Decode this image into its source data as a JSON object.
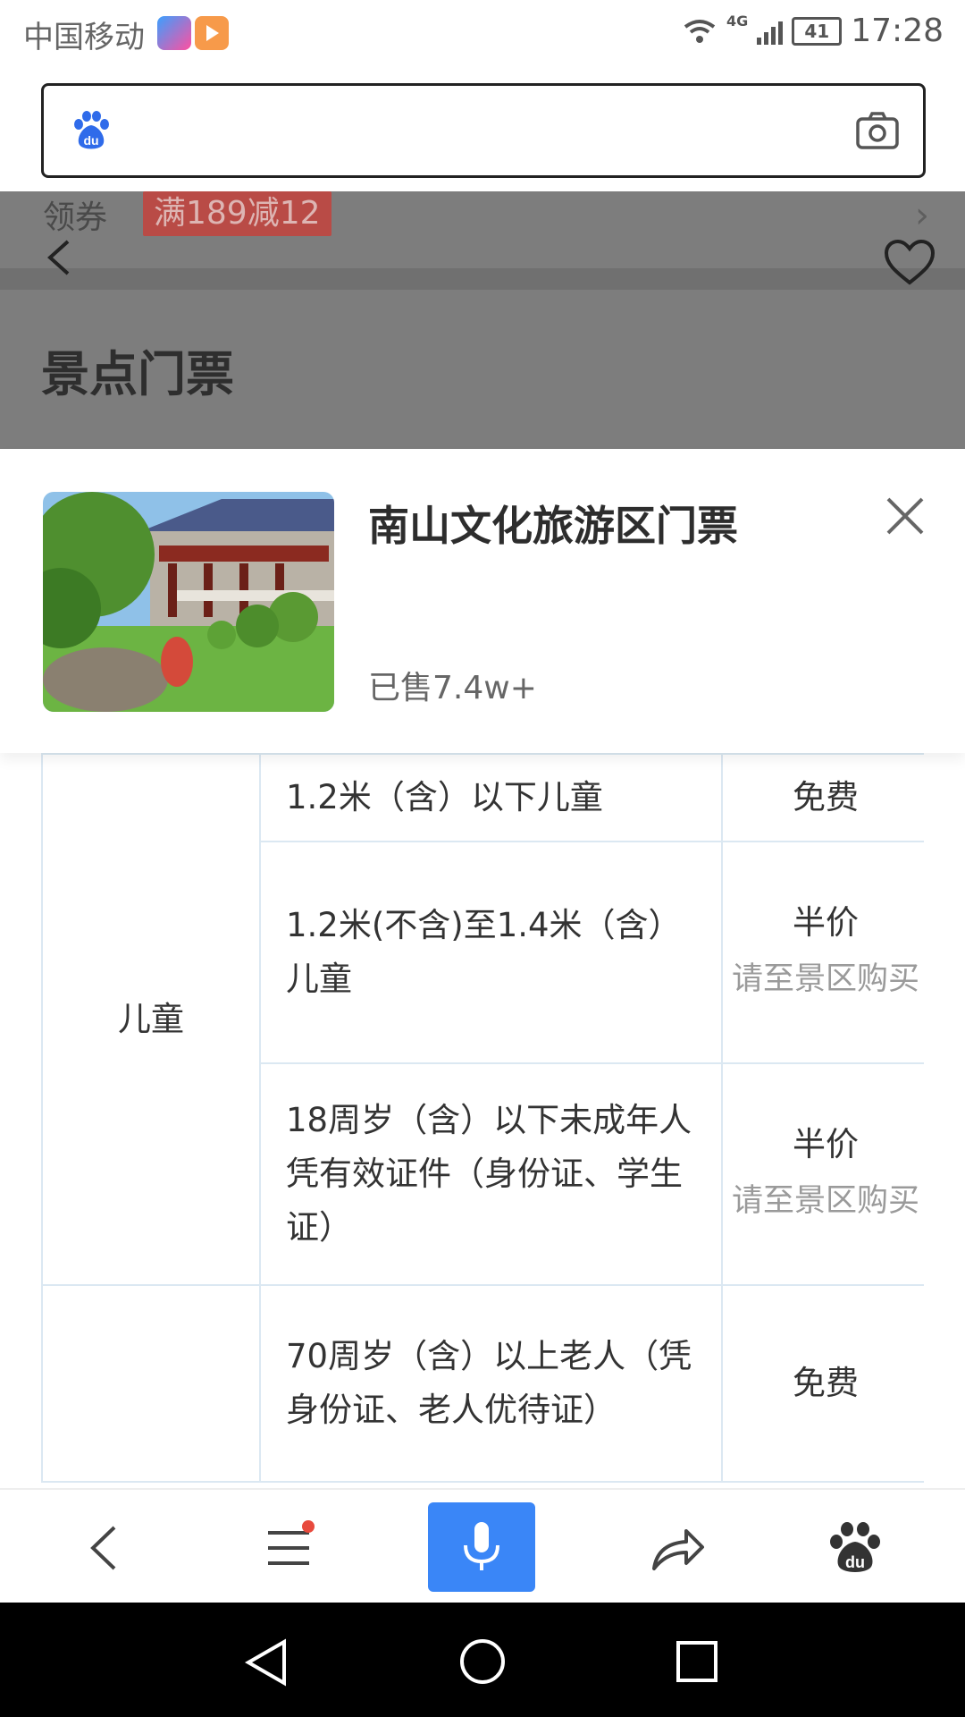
{
  "status_bar": {
    "carrier": "中国移动",
    "network": "4G",
    "battery": "41",
    "time": "17:28"
  },
  "search": {
    "value": ""
  },
  "background_page": {
    "coupon_label": "领券",
    "coupon_offer": "满189减12",
    "section_title": "景点门票"
  },
  "product": {
    "title": "南山文化旅游区门票",
    "sold": "已售7.4w+"
  },
  "ticket_table": {
    "rows": [
      {
        "category": "儿童",
        "condition": "1.2米（含）以下儿童",
        "price": "免费",
        "note": ""
      },
      {
        "category": "",
        "condition": "1.2米(不含)至1.4米（含）儿童",
        "price": "半价",
        "note": "请至景区购买"
      },
      {
        "category": "",
        "condition": "18周岁（含）以下未成年人凭有效证件（身份证、学生证）",
        "price": "半价",
        "note": "请至景区购买"
      },
      {
        "category": "",
        "condition": "70周岁（含）以上老人（凭身份证、老人优待证）",
        "price": "免费",
        "note": ""
      }
    ]
  },
  "colors": {
    "accent": "#3a86f7",
    "coupon": "#b94b46",
    "badge": "#e84a3d"
  },
  "icons": [
    "baidu-paw-icon",
    "camera-icon",
    "back-icon",
    "heart-icon",
    "close-icon",
    "menu-icon",
    "mic-icon",
    "share-icon",
    "triangle-back-icon",
    "circle-home-icon",
    "square-recent-icon"
  ]
}
